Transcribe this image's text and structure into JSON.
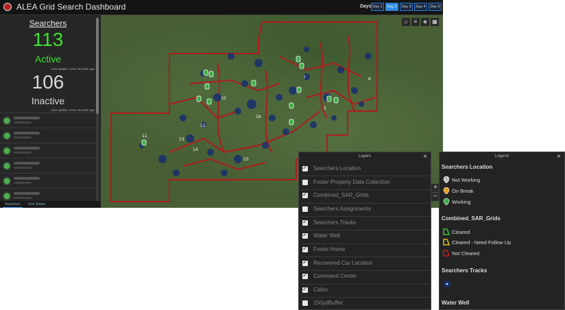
{
  "app": {
    "title": "ALEA Grid Search Dashboard"
  },
  "days": {
    "label": "Days",
    "tabs": [
      "Day 1",
      "Day 2",
      "Day 3",
      "Day 4",
      "Day 5"
    ],
    "active_index": 1
  },
  "searchers": {
    "title": "Searchers",
    "active_count": "113",
    "active_label": "Active",
    "inactive_count": "106",
    "inactive_label": "Inactive",
    "last_update": "Last update: a few seconds ago",
    "active_color": "#40e030"
  },
  "bottom_tabs": [
    "Searchers",
    "Grid Status"
  ],
  "map": {
    "grid_labels": [
      "5",
      "6",
      "7",
      "10",
      "11",
      "12",
      "13",
      "14",
      "15",
      "16"
    ],
    "tools": [
      "home-icon",
      "list-icon",
      "layers-icon",
      "grid-icon"
    ],
    "zoom_in": "+",
    "zoom_out": "−"
  },
  "layers_panel": {
    "title": "Layers",
    "items": [
      {
        "label": "Searchers Location",
        "checked": true
      },
      {
        "label": "Foster Property Data Collection",
        "checked": false
      },
      {
        "label": "Combined_SAR_Grids",
        "checked": true
      },
      {
        "label": "Searchers Assignments",
        "checked": false
      },
      {
        "label": "Searchers Tracks",
        "checked": true
      },
      {
        "label": "Water Well",
        "checked": true
      },
      {
        "label": "Foster Home",
        "checked": true
      },
      {
        "label": "Recovered Car Location",
        "checked": true
      },
      {
        "label": "Command Center",
        "checked": true
      },
      {
        "label": "Cabin",
        "checked": true
      },
      {
        "label": "150ydBuffer",
        "checked": false
      }
    ]
  },
  "legend_panel": {
    "title": "Legend",
    "searchers_location": {
      "heading": "Searchers Location",
      "items": [
        "Not Working",
        "On Break",
        "Working"
      ],
      "colors": [
        "#bfbfbf",
        "#e0a020",
        "#3fae49"
      ]
    },
    "grids": {
      "heading": "Combined_SAR_Grids",
      "items": [
        "Cleared",
        "Cleared - Need Follow Up",
        "Not Cleared"
      ],
      "colors": [
        "#3fbf3f",
        "#e0c020",
        "#c02020"
      ]
    },
    "tracks": {
      "heading": "Searchers Tracks"
    },
    "water_well": {
      "heading": "Water Well"
    }
  }
}
